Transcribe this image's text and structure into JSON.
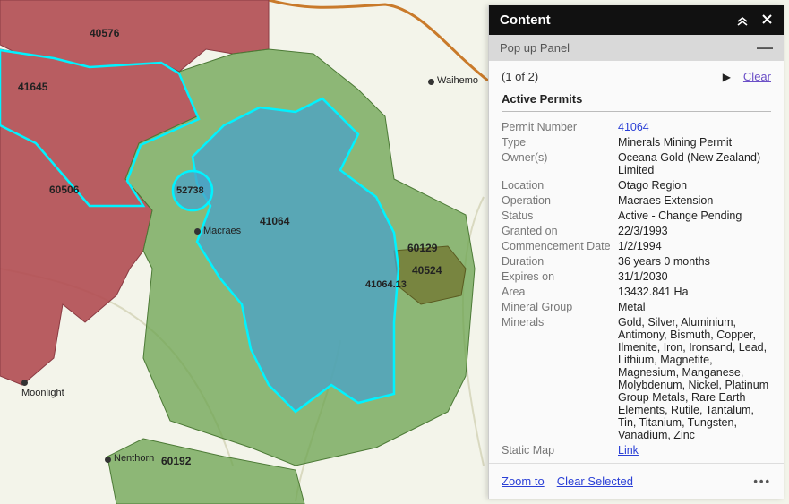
{
  "map": {
    "labels": {
      "permit_40576": "40576",
      "permit_41645": "41645",
      "permit_60506": "60506",
      "permit_52738": "52738",
      "permit_41064": "41064",
      "permit_60129": "60129",
      "permit_40524": "40524",
      "permit_41064_13": "41064.13",
      "permit_60192": "60192"
    },
    "places": {
      "waihemo": "Waihemo",
      "macraes": "Macraes",
      "moonlight": "Moonlight",
      "nenthorn": "Nenthorn"
    }
  },
  "panel": {
    "header_title": "Content",
    "sub_header_title": "Pop up Panel",
    "pager_text": "(1 of 2)",
    "clear_label": "Clear",
    "section_title": "Active Permits",
    "rows": {
      "permit_number": {
        "k": "Permit Number",
        "v": "41064"
      },
      "type_": {
        "k": "Type",
        "v": "Minerals Mining Permit"
      },
      "owners": {
        "k": "Owner(s)",
        "v": "Oceana Gold (New Zealand) Limited"
      },
      "location": {
        "k": "Location",
        "v": "Otago Region"
      },
      "operation": {
        "k": "Operation",
        "v": "Macraes Extension"
      },
      "status": {
        "k": "Status",
        "v": "Active - Change Pending"
      },
      "granted_on": {
        "k": "Granted on",
        "v": "22/3/1993"
      },
      "commencement": {
        "k": "Commencement Date",
        "v": "1/2/1994"
      },
      "duration": {
        "k": "Duration",
        "v": "36 years 0 months"
      },
      "expires_on": {
        "k": "Expires on",
        "v": "31/1/2030"
      },
      "area": {
        "k": "Area",
        "v": "13432.841 Ha"
      },
      "mineral_group": {
        "k": "Mineral Group",
        "v": "Metal"
      },
      "minerals": {
        "k": "Minerals",
        "v": "Gold, Silver, Aluminium, Antimony, Bismuth, Copper, Ilmenite, Iron, Ironsand, Lead, Lithium, Magnetite, Magnesium, Manganese, Molybdenum, Nickel, Platinum Group Metals, Rare Earth Elements, Rutile, Tantalum, Tin, Titanium, Tungsten, Vanadium, Zinc"
      },
      "static_map": {
        "k": "Static Map",
        "v": "Link"
      }
    },
    "footer": {
      "zoom_to": "Zoom to",
      "clear_selected": "Clear Selected"
    }
  }
}
